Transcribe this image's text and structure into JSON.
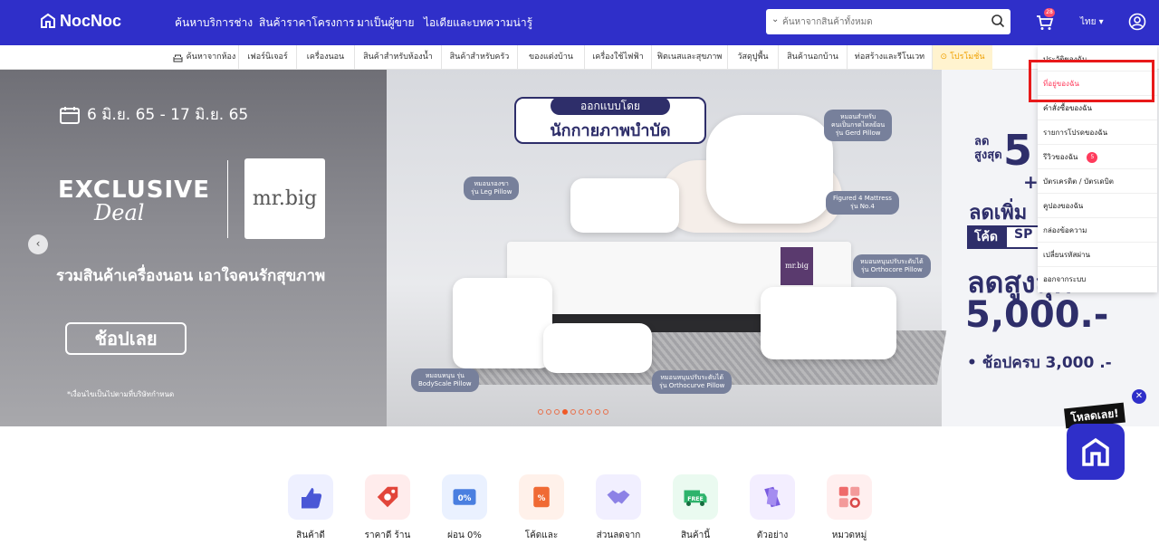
{
  "header": {
    "brand": "NocNoc",
    "nav": [
      "ค้นหาบริการช่าง",
      "สินค้าราคาโครงการ",
      "มาเป็นผู้ขาย",
      "ไอเดียและบทความน่ารู้"
    ],
    "search_placeholder": "ค้นหาจากสินค้าทั้งหมด",
    "cart_count": "28",
    "language": "ไทย ▾"
  },
  "categories": [
    "ค้นหาจากห้อง",
    "เฟอร์นิเจอร์",
    "เครื่องนอน",
    "สินค้าสำหรับห้องน้ำ",
    "สินค้าสำหรับครัว",
    "ของแต่งบ้าน",
    "เครื่องใช้ไฟฟ้า",
    "ฟิตเนสและสุขภาพ",
    "วัสดุปูพื้น",
    "สินค้านอกบ้าน",
    "ท่อสร้างและรีโนเวท",
    "โปรโมชั่น"
  ],
  "banner": {
    "date": "6 มิ.ย. 65 - 17 มิ.ย. 65",
    "exclusive": "EXCLUSIVE",
    "deal": "Deal",
    "brand_logo": "mr.big",
    "tagline": "รวมสินค้าเครื่องนอน เอาใจคนรักสุขภาพ",
    "shop_button": "ช้อปเลย",
    "condition": "*เงื่อนไขเป็นไปตามที่บริษัทกำหนด",
    "designed_by_1": "ออกแบบโดย",
    "designed_by_2": "นักกายภาพบำบัด",
    "chips": [
      "หมอนรองขา\nรุ่น Leg Pillow",
      "หมอนสำหรับ\nคนเป็นกรดไหลย้อน\nรุ่น Gerd Pillow",
      "Figured 4 Mattress\nรุ่น No.4",
      "หมอนหนุนปรับระดับได้\nรุ่น Orthocore Pillow",
      "หมอนหนุน รุ่น\nBodyScale Pillow",
      "หมอนหนุนปรับระดับได้\nรุ่น Orthocurve Pillow"
    ],
    "bed_label": "mr.big",
    "right": {
      "sale_label": "ลด\nสูงสุด",
      "sale_value": "5",
      "plus": "+",
      "code_text": "ลดเพิ่ม",
      "code_key": "โค้ด",
      "code_value": "SP",
      "big": "ลดสูงสุด",
      "amount": "5,000.-",
      "buy": "• ช้อปครบ 3,000 .-"
    },
    "slide_count": 9,
    "active_slide": 4
  },
  "account_menu": [
    "ประวัติของฉัน",
    "ที่อยู่ของฉัน",
    "คำสั่งซื้อของฉัน",
    "รายการโปรดของฉัน",
    "รีวิวของฉัน",
    "บัตรเครดิต / บัตรเดบิต",
    "คูปองของฉัน",
    "กล่องข้อความ",
    "เปลี่ยนรหัสผ่าน",
    "ออกจากระบบ"
  ],
  "review_badge": "5",
  "features": [
    {
      "label": "สินค้าดี",
      "icon": "thumbs-up-icon",
      "bg": "#eef0ff"
    },
    {
      "label": "ราคาดี ร้าน",
      "icon": "price-tag-icon",
      "bg": "#ffecec"
    },
    {
      "label": "ผ่อน 0%",
      "icon": "credit-card-icon",
      "bg": "#eaf1ff",
      "mark": "0%"
    },
    {
      "label": "โค้ดและ",
      "icon": "coupon-icon",
      "bg": "#fff1ea",
      "mark": "%"
    },
    {
      "label": "ส่วนลดจาก",
      "icon": "handshake-icon",
      "bg": "#f1efff"
    },
    {
      "label": "สินค้านี้",
      "icon": "free-truck-icon",
      "bg": "#eafaf0",
      "mark": "FREE"
    },
    {
      "label": "ตัวอย่าง",
      "icon": "free-sample-icon",
      "bg": "#f3eeff"
    },
    {
      "label": "หมวดหมู่",
      "icon": "category-icon",
      "bg": "#ffefef"
    }
  ],
  "app_ad": {
    "close": "✕",
    "download": "โหลดเลย!"
  }
}
